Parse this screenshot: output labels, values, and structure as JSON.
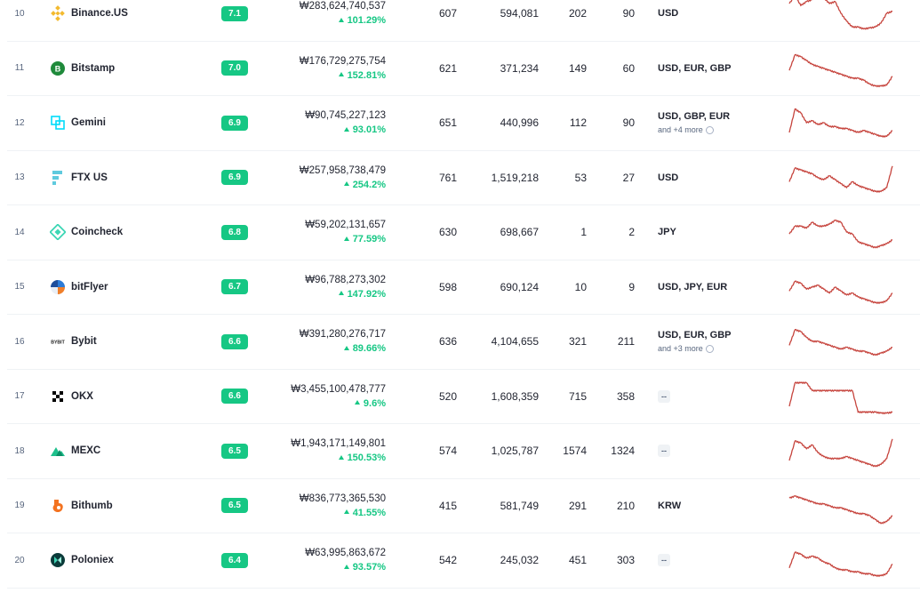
{
  "colors": {
    "accent_green": "#16c784",
    "spark_red": "#c6443d"
  },
  "rows": [
    {
      "rank": "10",
      "name": "Binance.US",
      "logo": "binance-logo-icon",
      "score": "7.1",
      "volume": "₩283,624,740,537",
      "change": "101.29%",
      "markets": "607",
      "coins": "594,081",
      "pairs": "202",
      "fiat_count": "90",
      "fiat": "USD",
      "more": "",
      "spark": [
        10,
        2,
        12,
        8,
        6,
        3,
        4,
        10,
        8,
        20,
        28,
        34,
        34,
        36,
        35,
        34,
        30,
        20,
        18
      ]
    },
    {
      "rank": "11",
      "name": "Bitstamp",
      "logo": "bitstamp-logo-icon",
      "score": "7.0",
      "volume": "₩176,729,275,754",
      "change": "152.81%",
      "markets": "621",
      "coins": "371,234",
      "pairs": "149",
      "fiat_count": "60",
      "fiat": "USD, EUR, GBP",
      "more": "",
      "spark": [
        22,
        6,
        8,
        12,
        16,
        18,
        20,
        22,
        24,
        26,
        28,
        30,
        30,
        32,
        36,
        38,
        38,
        37,
        28
      ]
    },
    {
      "rank": "12",
      "name": "Gemini",
      "logo": "gemini-logo-icon",
      "score": "6.9",
      "volume": "₩90,745,227,123",
      "change": "93.01%",
      "markets": "651",
      "coins": "440,996",
      "pairs": "112",
      "fiat_count": "90",
      "fiat": "USD, GBP, EUR",
      "more": "and +4 more",
      "spark": [
        30,
        6,
        10,
        20,
        18,
        22,
        20,
        24,
        24,
        26,
        26,
        28,
        30,
        28,
        30,
        32,
        34,
        34,
        28
      ]
    },
    {
      "rank": "13",
      "name": "FTX US",
      "logo": "ftx-logo-icon",
      "score": "6.9",
      "volume": "₩257,958,738,479",
      "change": "254.2%",
      "markets": "761",
      "coins": "1,519,218",
      "pairs": "53",
      "fiat_count": "27",
      "fiat": "USD",
      "more": "",
      "spark": [
        24,
        10,
        12,
        14,
        16,
        20,
        22,
        18,
        22,
        26,
        30,
        24,
        28,
        30,
        32,
        34,
        34,
        30,
        8
      ]
    },
    {
      "rank": "14",
      "name": "Coincheck",
      "logo": "coincheck-logo-icon",
      "score": "6.8",
      "volume": "₩59,202,131,657",
      "change": "77.59%",
      "markets": "630",
      "coins": "698,667",
      "pairs": "1",
      "fiat_count": "2",
      "fiat": "JPY",
      "more": "",
      "spark": [
        22,
        14,
        14,
        16,
        10,
        14,
        14,
        12,
        8,
        10,
        20,
        22,
        30,
        32,
        34,
        36,
        34,
        32,
        28
      ]
    },
    {
      "rank": "15",
      "name": "bitFlyer",
      "logo": "bitflyer-logo-icon",
      "score": "6.7",
      "volume": "₩96,788,273,302",
      "change": "147.92%",
      "markets": "598",
      "coins": "690,124",
      "pairs": "10",
      "fiat_count": "9",
      "fiat": "USD, JPY, EUR",
      "more": "",
      "spark": [
        24,
        14,
        16,
        22,
        20,
        18,
        22,
        26,
        20,
        24,
        28,
        26,
        30,
        32,
        34,
        36,
        36,
        34,
        26
      ]
    },
    {
      "rank": "16",
      "name": "Bybit",
      "logo": "bybit-logo-icon",
      "score": "6.6",
      "volume": "₩391,280,276,717",
      "change": "89.66%",
      "markets": "636",
      "coins": "4,104,655",
      "pairs": "321",
      "fiat_count": "211",
      "fiat": "USD, EUR, GBP",
      "more": "and +3 more",
      "spark": [
        24,
        8,
        10,
        16,
        20,
        20,
        22,
        24,
        26,
        28,
        26,
        28,
        30,
        30,
        32,
        34,
        32,
        30,
        26
      ]
    },
    {
      "rank": "17",
      "name": "OKX",
      "logo": "okx-logo-icon",
      "score": "6.6",
      "volume": "₩3,455,100,478,777",
      "change": "9.6%",
      "markets": "520",
      "coins": "1,608,359",
      "pairs": "715",
      "fiat_count": "358",
      "fiat": "",
      "more": "",
      "spark": [
        30,
        6,
        6,
        6,
        14,
        14,
        14,
        14,
        14,
        14,
        14,
        14,
        36,
        36,
        36,
        36,
        37,
        37,
        36
      ]
    },
    {
      "rank": "18",
      "name": "MEXC",
      "logo": "mexc-logo-icon",
      "score": "6.5",
      "volume": "₩1,943,171,149,801",
      "change": "150.53%",
      "markets": "574",
      "coins": "1,025,787",
      "pairs": "1574",
      "fiat_count": "1324",
      "fiat": "",
      "more": "",
      "spark": [
        30,
        10,
        12,
        18,
        14,
        22,
        26,
        28,
        28,
        28,
        26,
        28,
        30,
        32,
        34,
        36,
        34,
        28,
        8
      ]
    },
    {
      "rank": "19",
      "name": "Bithumb",
      "logo": "bithumb-logo-icon",
      "score": "6.5",
      "volume": "₩836,773,365,530",
      "change": "41.55%",
      "markets": "415",
      "coins": "581,749",
      "pairs": "291",
      "fiat_count": "210",
      "fiat": "KRW",
      "more": "",
      "spark": [
        12,
        10,
        12,
        14,
        16,
        18,
        18,
        20,
        22,
        22,
        24,
        26,
        28,
        28,
        30,
        34,
        38,
        36,
        30
      ]
    },
    {
      "rank": "20",
      "name": "Poloniex",
      "logo": "poloniex-logo-icon",
      "score": "6.4",
      "volume": "₩63,995,863,672",
      "change": "93.57%",
      "markets": "542",
      "coins": "245,032",
      "pairs": "451",
      "fiat_count": "303",
      "fiat": "",
      "more": "",
      "spark": [
        28,
        12,
        14,
        18,
        16,
        18,
        22,
        24,
        28,
        30,
        30,
        32,
        32,
        34,
        34,
        36,
        36,
        34,
        24
      ]
    }
  ]
}
